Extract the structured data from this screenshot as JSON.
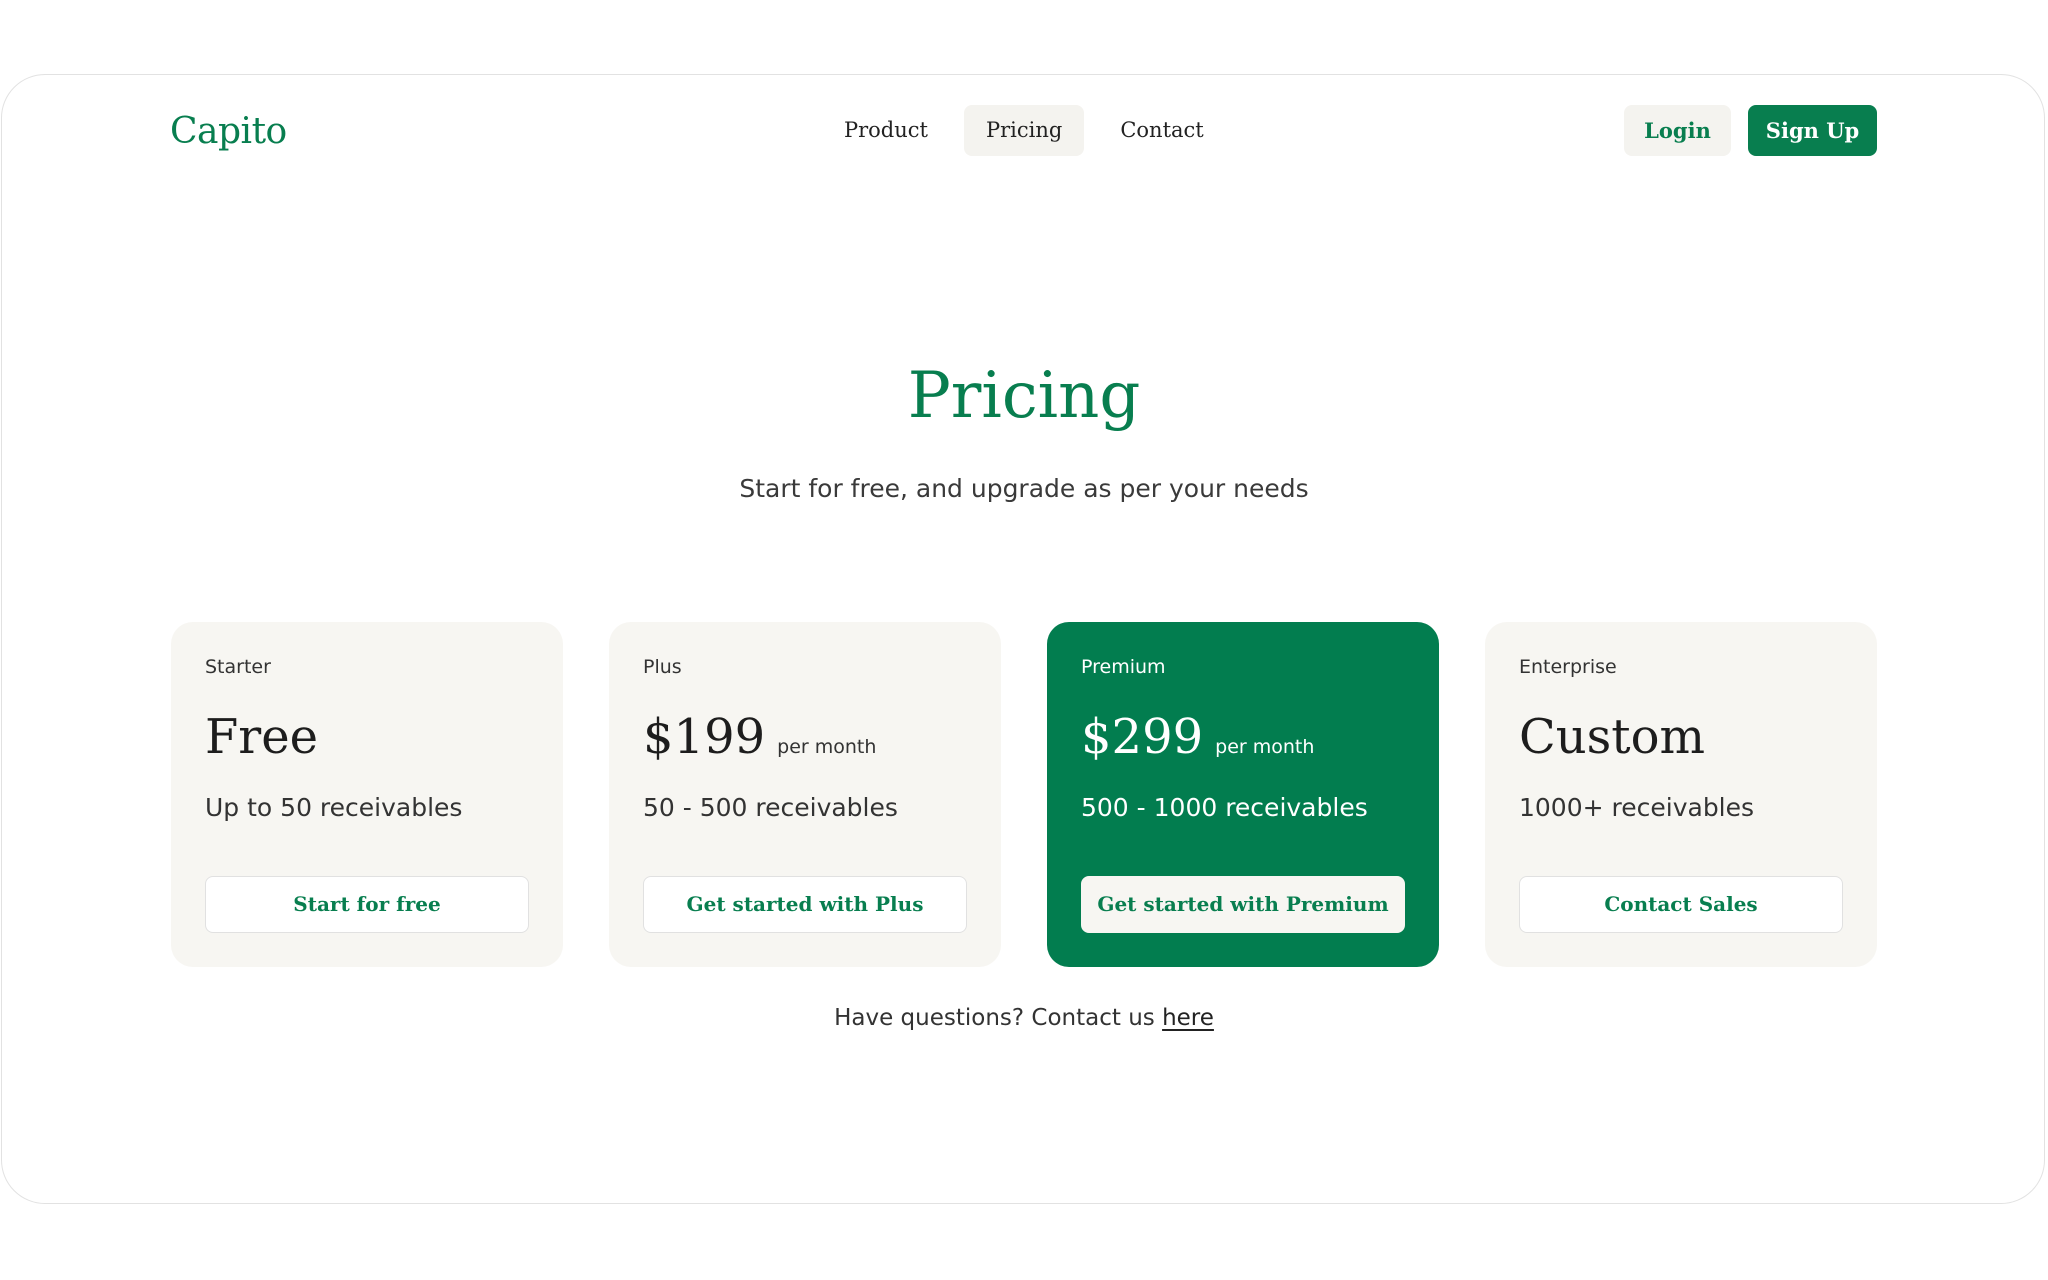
{
  "brand": {
    "name": "Capito",
    "accent": "#087e4f"
  },
  "nav": {
    "items": [
      {
        "label": "Product"
      },
      {
        "label": "Pricing",
        "active": true
      },
      {
        "label": "Contact"
      }
    ]
  },
  "auth": {
    "login_label": "Login",
    "signup_label": "Sign Up"
  },
  "hero": {
    "title": "Pricing",
    "subtitle": "Start for free, and upgrade as per your needs"
  },
  "plans": [
    {
      "tier": "Starter",
      "price": "Free",
      "period": "",
      "quota": "Up to 50 receivables",
      "cta": "Start for free"
    },
    {
      "tier": "Plus",
      "price": "$199",
      "period": "per month",
      "quota": "50 - 500 receivables",
      "cta": "Get started with Plus"
    },
    {
      "tier": "Premium",
      "price": "$299",
      "period": "per month",
      "quota": "500 - 1000 receivables",
      "cta": "Get started with Premium",
      "featured": true
    },
    {
      "tier": "Enterprise",
      "price": "Custom",
      "period": "",
      "quota": "1000+ receivables",
      "cta": "Contact Sales"
    }
  ],
  "footer": {
    "question": "Have questions? Contact us",
    "link_label": "here"
  }
}
